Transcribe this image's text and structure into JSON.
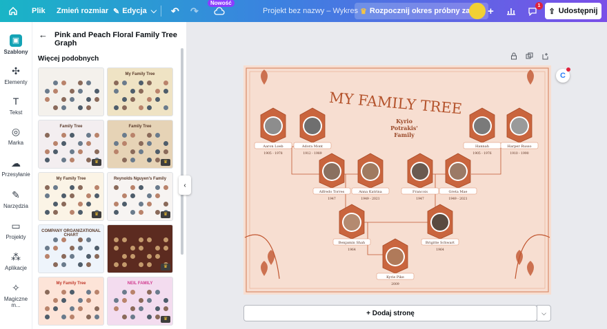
{
  "topbar": {
    "file_label": "Plik",
    "resize_label": "Zmień rozmiar",
    "edit_label": "Edycja",
    "new_badge": "Nowość",
    "doc_title": "Projekt bez nazwy – Wykres",
    "trial_label": "Rozpocznij okres próbny za 0 €",
    "notification_count": "1",
    "share_label": "Udostępnij"
  },
  "rail": {
    "items": [
      {
        "label": "Szablony",
        "icon": "templates-icon"
      },
      {
        "label": "Elementy",
        "icon": "elements-icon"
      },
      {
        "label": "Tekst",
        "icon": "text-icon"
      },
      {
        "label": "Marka",
        "icon": "brand-icon"
      },
      {
        "label": "Przesyłanie",
        "icon": "upload-icon"
      },
      {
        "label": "Narzędzia",
        "icon": "tools-icon"
      },
      {
        "label": "Projekty",
        "icon": "folder-icon"
      },
      {
        "label": "Aplikacje",
        "icon": "apps-icon"
      },
      {
        "label": "Magiczne m...",
        "icon": "magic-icon"
      }
    ]
  },
  "panel": {
    "title": "Pink and Peach Floral Family Tree Graph",
    "section": "Więcej podobnych",
    "thumbs": [
      {
        "title": "",
        "bg": "#f4f1ec",
        "premium": false
      },
      {
        "title": "My Family Tree",
        "bg": "#efe3c4",
        "premium": false
      },
      {
        "title": "Family Tree",
        "bg": "#f3eef0",
        "premium": true
      },
      {
        "title": "Family Tree",
        "bg": "#e6d3b6",
        "premium": true
      },
      {
        "title": "My Family Tree",
        "bg": "#fbf4e6",
        "premium": true
      },
      {
        "title": "Reynolds Nguyen's Family",
        "bg": "#f7f4f2",
        "premium": true
      },
      {
        "title": "COMPANY ORGANIZATIONAL CHART",
        "bg": "#eef4fb",
        "premium": false
      },
      {
        "title": "",
        "bg": "#5c2b20",
        "premium": true
      },
      {
        "title": "My Family Tree",
        "bg": "#fde4d8",
        "premium": false
      },
      {
        "title": "NEIL FAMILY",
        "bg": "#f3dcef",
        "premium": true
      }
    ]
  },
  "design": {
    "title": "MY FAMILY TREE",
    "family_name": "Kyrio Potrakis' Family",
    "members": [
      {
        "name": "Aaron Loeb",
        "years": "1905 - 1978"
      },
      {
        "name": "Adora Mont",
        "years": "1912 - 1989"
      },
      {
        "name": "Hannah",
        "years": "1905 - 1976"
      },
      {
        "name": "Harper Russo",
        "years": "1910 - 1990"
      },
      {
        "name": "Alfredo Torres",
        "years": "1947"
      },
      {
        "name": "Anna Katrina",
        "years": "1949 - 2021"
      },
      {
        "name": "Francois",
        "years": "1947"
      },
      {
        "name": "Greta Mae",
        "years": "1949 - 2021"
      },
      {
        "name": "Benjamin Shah",
        "years": "1964"
      },
      {
        "name": "Brigitte Schwart",
        "years": "1964"
      },
      {
        "name": "Kyrie Pike",
        "years": "2009"
      }
    ]
  },
  "canvas_controls": {
    "add_page": "+ Dodaj stronę"
  },
  "colors": {
    "accent": "#c0552f",
    "canvas_bg": "#f7ded1",
    "brand_purple": "#8b3dff"
  }
}
